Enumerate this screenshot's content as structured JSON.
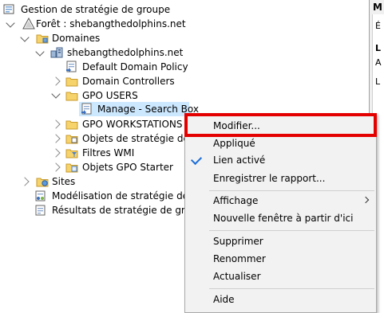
{
  "tree": {
    "root": "Gestion de stratégie de groupe",
    "forest": "Forêt : shebangthedolphins.net",
    "domains": "Domaines",
    "domain": "shebangthedolphins.net",
    "default_policy": "Default Domain Policy",
    "domain_controllers": "Domain Controllers",
    "gpo_users": "GPO USERS",
    "selected_link": "Manage - Search Box",
    "gpo_workstations": "GPO WORKSTATIONS",
    "gpo_objects": "Objets de stratégie de gr",
    "wmi_filters": "Filtres WMI",
    "starter_gpos": "Objets GPO Starter",
    "sites": "Sites",
    "modeling": "Modélisation de stratégie de gro",
    "results": "Résultats de stratégie de groupe"
  },
  "right_panel": {
    "title": "M",
    "line1": "É",
    "line2": "L",
    "line3": "A",
    "line4": "L"
  },
  "context_menu": {
    "items": [
      {
        "label": "Modifier..."
      },
      {
        "label": "Appliqué"
      },
      {
        "label": "Lien activé",
        "checked": true
      },
      {
        "label": "Enregistrer le rapport..."
      },
      {
        "label": "Affichage",
        "submenu": true
      },
      {
        "label": "Nouvelle fenêtre à partir d'ici"
      },
      {
        "label": "Supprimer"
      },
      {
        "label": "Renommer"
      },
      {
        "label": "Actualiser"
      },
      {
        "label": "Aide"
      }
    ]
  },
  "colors": {
    "selection": "#cce8ff",
    "highlight_box": "#e50000",
    "check": "#1e6fd9"
  },
  "icons": [
    "gpmc-root-icon",
    "forest-icon",
    "domains-folder-icon",
    "domain-icon",
    "gpo-icon",
    "folder-icon",
    "gpo-link-icon",
    "sites-icon",
    "modeling-icon",
    "results-icon",
    "checkmark-icon",
    "submenu-arrow-icon"
  ]
}
